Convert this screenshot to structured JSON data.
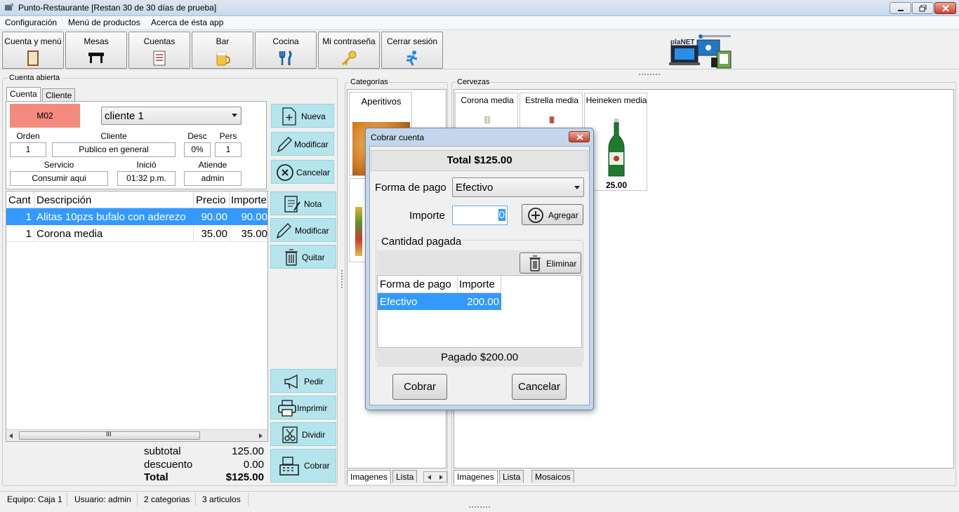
{
  "window": {
    "title": "Punto-Restaurante [Restan 30 de 30 días de prueba]"
  },
  "menu": [
    "Configuración",
    "Menú de productos",
    "Acerca de ésta app"
  ],
  "toolbar": {
    "buttons": [
      "Cuenta y menú",
      "Mesas",
      "Cuentas",
      "Bar",
      "Cocina",
      "Mi contraseña",
      "Cerrar sesión"
    ],
    "logo_text": "plaNET"
  },
  "cuenta": {
    "group_title": "Cuenta abierta",
    "tabs": [
      "Cuenta",
      "Cliente"
    ],
    "table_id": "M02",
    "client_select": "cliente 1",
    "labels": {
      "orden": "Orden",
      "cliente": "Cliente",
      "desc": "Desc",
      "pers": "Pers",
      "servicio": "Servicio",
      "inicio": "Inició",
      "atiende": "Atiende"
    },
    "values": {
      "orden": "1",
      "cliente": "Publico en general",
      "desc": "0%",
      "pers": "1",
      "servicio": "Consumir aqui",
      "inicio": "01:32 p.m.",
      "atiende": "admin"
    },
    "actions": [
      "Nueva",
      "Modificar",
      "Cancelar"
    ],
    "item_actions": [
      "Nota",
      "Modificar",
      "Quitar"
    ],
    "bottom_actions": [
      "Pedir",
      "Imprimir",
      "Dividir",
      "Cobrar"
    ],
    "columns": [
      "Cant",
      "Descripción",
      "Precio",
      "Importe"
    ],
    "rows": [
      {
        "cant": "1",
        "desc": "Alitas 10pzs bufalo con aderezo",
        "precio": "90.00",
        "importe": "90.00"
      },
      {
        "cant": "1",
        "desc": "Corona media",
        "precio": "35.00",
        "importe": "35.00"
      }
    ],
    "scroll_grip": "III",
    "totals": {
      "subtotal_label": "subtotal",
      "subtotal": "125.00",
      "descuento_label": "descuento",
      "descuento": "0.00",
      "total_label": "Total",
      "total": "$125.00"
    }
  },
  "categorias": {
    "group_title": "Categorías",
    "items": [
      "Aperitivos"
    ],
    "tabs": [
      "Imagenes",
      "Lista"
    ]
  },
  "cervezas": {
    "group_title": "Cervezas",
    "items": [
      {
        "name": "Corona media"
      },
      {
        "name": "Estrella media"
      },
      {
        "name": "Heineken media",
        "price": "25.00"
      }
    ],
    "tabs": [
      "Imagenes",
      "Lista",
      "Mosaicos"
    ]
  },
  "dialog": {
    "title": "Cobrar cuenta",
    "total": "Total $125.00",
    "forma_label": "Forma de pago",
    "forma_value": "Efectivo",
    "importe_label": "Importe",
    "importe_value": "0",
    "agregar": "Agregar",
    "pagada_group": "Cantidad pagada",
    "eliminar": "Eliminar",
    "columns": [
      "Forma de pago",
      "Importe"
    ],
    "rows": [
      {
        "forma": "Efectivo",
        "importe": "200.00"
      }
    ],
    "pagado": "Pagado $200.00",
    "cobrar": "Cobrar",
    "cancelar": "Cancelar"
  },
  "status": [
    "Equipo: Caja 1",
    "Usuario: admin",
    "2 categorias",
    "3 articulos"
  ],
  "colors": {
    "selection": "#3399ff",
    "table_badge": "#f28b7e",
    "action_button": "#b4e5ec"
  }
}
